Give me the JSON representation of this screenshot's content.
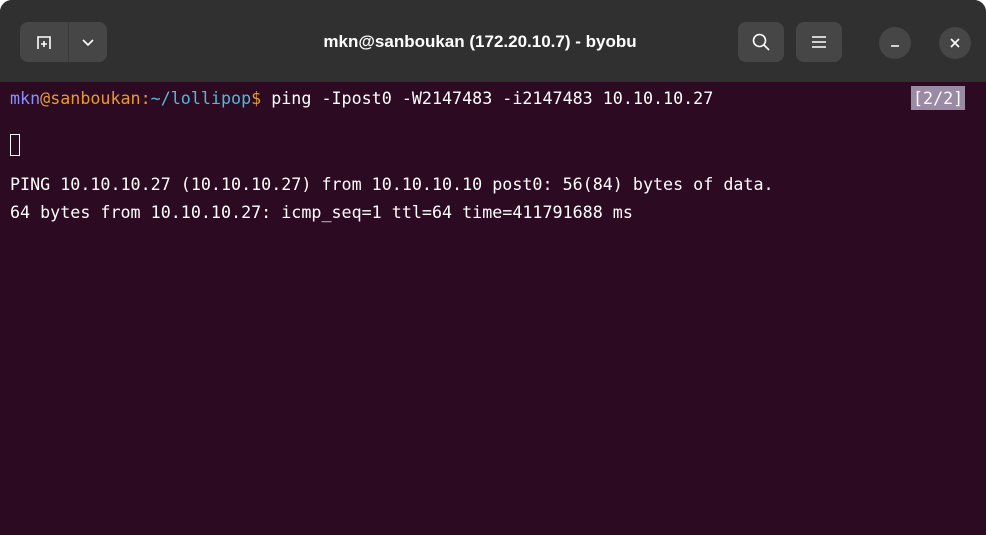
{
  "window": {
    "title": "mkn@sanboukan (172.20.10.7) - byobu"
  },
  "titlebar": {
    "icons": {
      "new_tab": "new-tab-icon",
      "tab_menu": "chevron-down-icon",
      "search": "search-icon",
      "menu": "hamburger-menu-icon",
      "minimize": "minimize-icon",
      "close": "close-icon"
    }
  },
  "terminal": {
    "prompt": {
      "user": "mkn",
      "at": "@",
      "host": "sanboukan",
      "colon": ":",
      "path": "~/lollipop",
      "dollar": "$",
      "command": " ping -Ipost0 -W2147483 -i2147483 10.10.10.27"
    },
    "window_indicator": "[2/2]",
    "output": [
      "PING 10.10.10.27 (10.10.10.27) from 10.10.10.10 post0: 56(84) bytes of data.",
      "64 bytes from 10.10.10.27: icmp_seq=1 ttl=64 time=411791688 ms"
    ]
  },
  "colors": {
    "terminal_bg": "#2c0a22",
    "titlebar_bg": "#303030",
    "user": "#8a8eff",
    "host": "#e59a33",
    "path": "#53b8d8"
  }
}
